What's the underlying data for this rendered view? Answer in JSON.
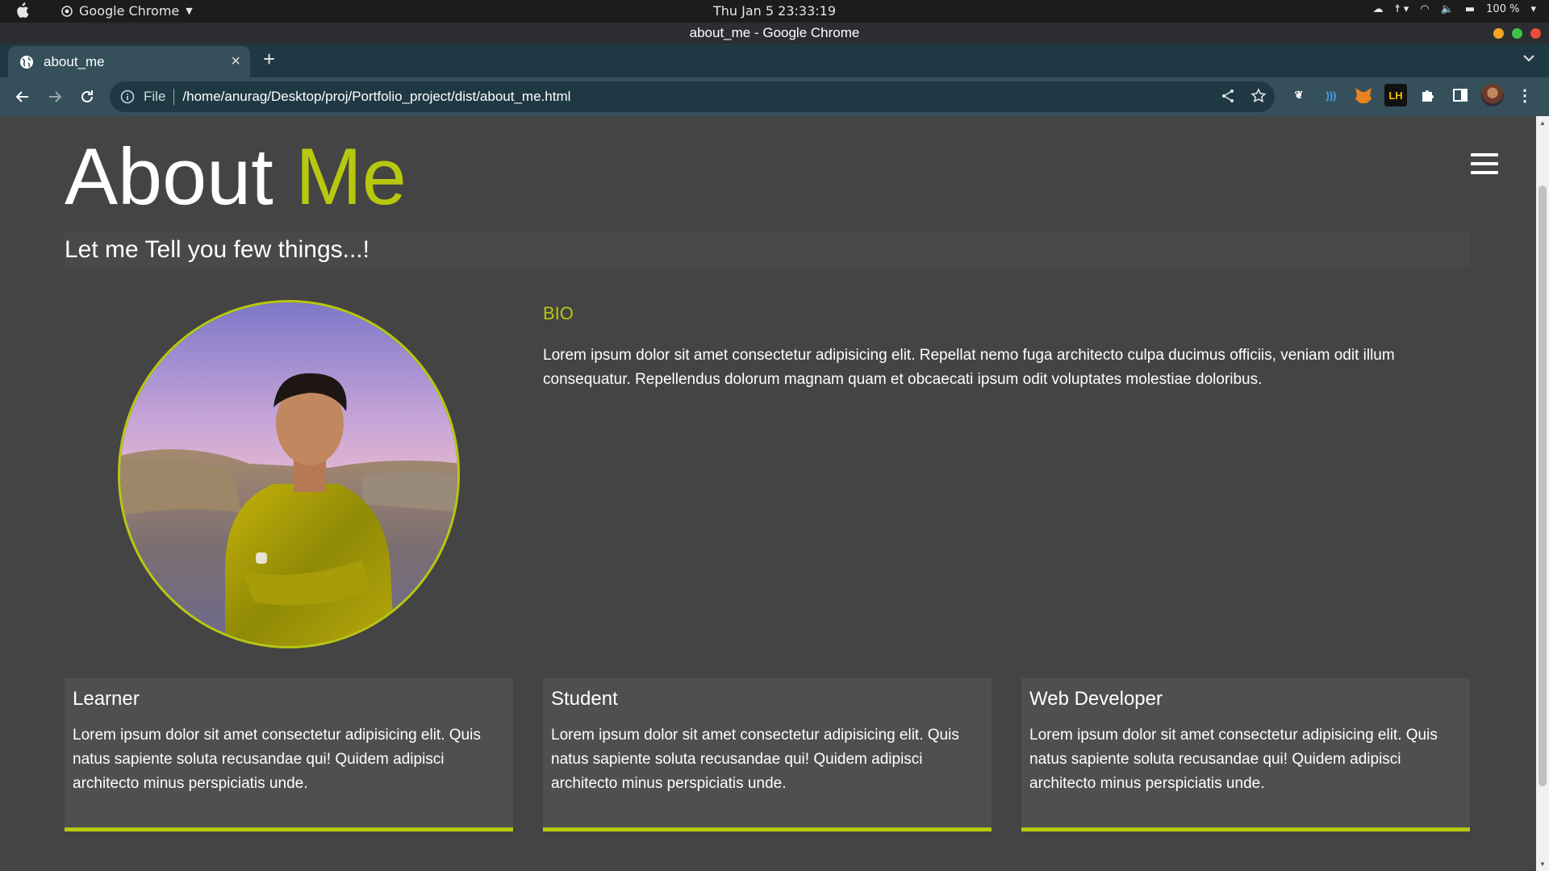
{
  "os": {
    "app_name": "Google Chrome",
    "clock": "Thu Jan 5  23:33:19",
    "battery": "100 %"
  },
  "window": {
    "title": "about_me - Google Chrome"
  },
  "tab": {
    "title": "about_me",
    "close_label": "×",
    "new_tab_label": "+"
  },
  "omnibox": {
    "scheme_label": "File",
    "url": "/home/anurag/Desktop/proj/Portfolio_project/dist/about_me.html"
  },
  "extensions": [
    "paw-icon",
    "wave-icon",
    "fox-icon",
    "LH",
    "puzzle-icon",
    "sidepanel-icon"
  ],
  "page": {
    "heading_main": "About",
    "heading_accent": "Me",
    "subtitle": "Let me Tell you few things...!",
    "bio": {
      "title": "BIO",
      "text": "Lorem ipsum dolor sit amet consectetur adipisicing elit. Repellat nemo fuga architecto culpa ducimus officiis, veniam odit illum consequatur. Repellendus dolorum magnam quam et obcaecati ipsum odit voluptates molestiae doloribus."
    },
    "cards": [
      {
        "title": "Learner",
        "text": "Lorem ipsum dolor sit amet consectetur adipisicing elit. Quis natus sapiente soluta recusandae qui! Quidem adipisci architecto minus perspiciatis unde."
      },
      {
        "title": "Student",
        "text": "Lorem ipsum dolor sit amet consectetur adipisicing elit. Quis natus sapiente soluta recusandae qui! Quidem adipisci architecto minus perspiciatis unde."
      },
      {
        "title": "Web Developer",
        "text": "Lorem ipsum dolor sit amet consectetur adipisicing elit. Quis natus sapiente soluta recusandae qui! Quidem adipisci architecto minus perspiciatis unde."
      }
    ]
  },
  "colors": {
    "accent": "#b8c80e",
    "page_bg": "#444444",
    "card_bg": "#4f4f4f",
    "tabstrip_bg": "#1f3944",
    "toolbar_bg": "#35505b"
  }
}
